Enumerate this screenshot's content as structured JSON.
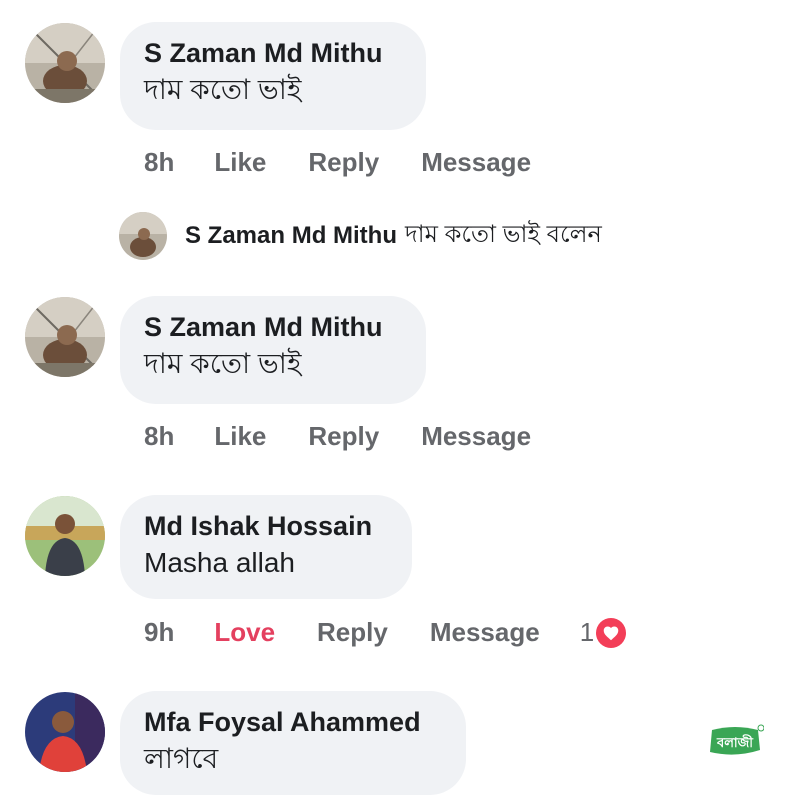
{
  "comments": [
    {
      "author": "S Zaman Md Mithu",
      "text": "দাম কতো ভাই",
      "time": "8h",
      "like": "Like",
      "reply": "Reply",
      "message": "Message"
    },
    {
      "author": "S Zaman Md Mithu",
      "text": "দাম কতো ভাই",
      "time": "8h",
      "like": "Like",
      "reply": "Reply",
      "message": "Message"
    },
    {
      "author": "Md Ishak Hossain",
      "text": "Masha allah",
      "time": "9h",
      "like": "Love",
      "reply": "Reply",
      "message": "Message",
      "reaction_count": "1",
      "reaction_icon": "heart-icon"
    },
    {
      "author": "Mfa Foysal Ahammed",
      "text": "লাগবে"
    }
  ],
  "collapsed_reply": {
    "author": "S Zaman Md Mithu",
    "text": "দাম কতো ভাই বলেন"
  },
  "colors": {
    "bubble": "#f0f2f5",
    "action_text": "#65676b",
    "love": "#e4405f",
    "heart_badge": "#f33e58",
    "watermark": "#3aa655"
  },
  "watermark": {
    "text": "বলাজী",
    "icon": "brand-logo"
  }
}
